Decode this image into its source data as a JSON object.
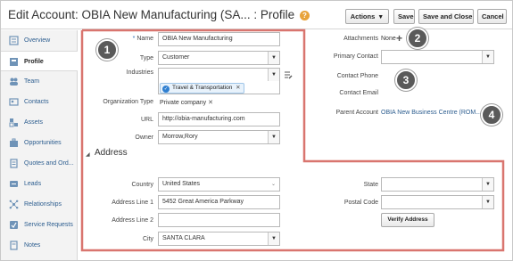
{
  "header": {
    "title": "Edit Account: OBIA New Manufacturing (SA... : Profile",
    "help_icon": "help-icon",
    "buttons": {
      "actions": "Actions",
      "save": "Save",
      "save_close": "Save and Close",
      "cancel": "Cancel"
    }
  },
  "sidebar": {
    "items": [
      {
        "label": "Overview",
        "icon": "overview-icon"
      },
      {
        "label": "Profile",
        "icon": "profile-icon"
      },
      {
        "label": "Team",
        "icon": "team-icon"
      },
      {
        "label": "Contacts",
        "icon": "contacts-icon"
      },
      {
        "label": "Assets",
        "icon": "assets-icon"
      },
      {
        "label": "Opportunities",
        "icon": "opportunities-icon"
      },
      {
        "label": "Quotes and Ord...",
        "icon": "quotes-icon"
      },
      {
        "label": "Leads",
        "icon": "leads-icon"
      },
      {
        "label": "Relationships",
        "icon": "relationships-icon"
      },
      {
        "label": "Service Requests",
        "icon": "service-requests-icon"
      },
      {
        "label": "Notes",
        "icon": "notes-icon"
      }
    ]
  },
  "form": {
    "name_label": "Name",
    "name_value": "OBIA New Manufacturing",
    "type_label": "Type",
    "type_value": "Customer",
    "industries_label": "Industries",
    "industry_chip": "Travel & Transportation",
    "org_type_label": "Organization Type",
    "org_type_value": "Private company",
    "url_label": "URL",
    "url_value": "http://obia-manufacturing.com",
    "owner_label": "Owner",
    "owner_value": "Morrow,Rory",
    "attachments_label": "Attachments",
    "attachments_value": "None",
    "primary_contact_label": "Primary Contact",
    "contact_phone_label": "Contact Phone",
    "contact_email_label": "Contact Email",
    "parent_account_label": "Parent Account",
    "parent_account_value": "OBIA New Business Centre (ROM..."
  },
  "address": {
    "section_title": "Address",
    "country_label": "Country",
    "country_value": "United States",
    "line1_label": "Address Line 1",
    "line1_value": "5452 Great America Parkway",
    "line2_label": "Address Line 2",
    "line2_value": "",
    "city_label": "City",
    "city_value": "SANTA CLARA",
    "state_label": "State",
    "state_value": "",
    "postal_label": "Postal Code",
    "postal_value": "",
    "verify_button": "Verify Address"
  },
  "callouts": [
    "1",
    "2",
    "3",
    "4"
  ],
  "colors": {
    "highlight": "#d9756f",
    "link": "#2c5d8f",
    "callout": "#5a5a5a"
  }
}
